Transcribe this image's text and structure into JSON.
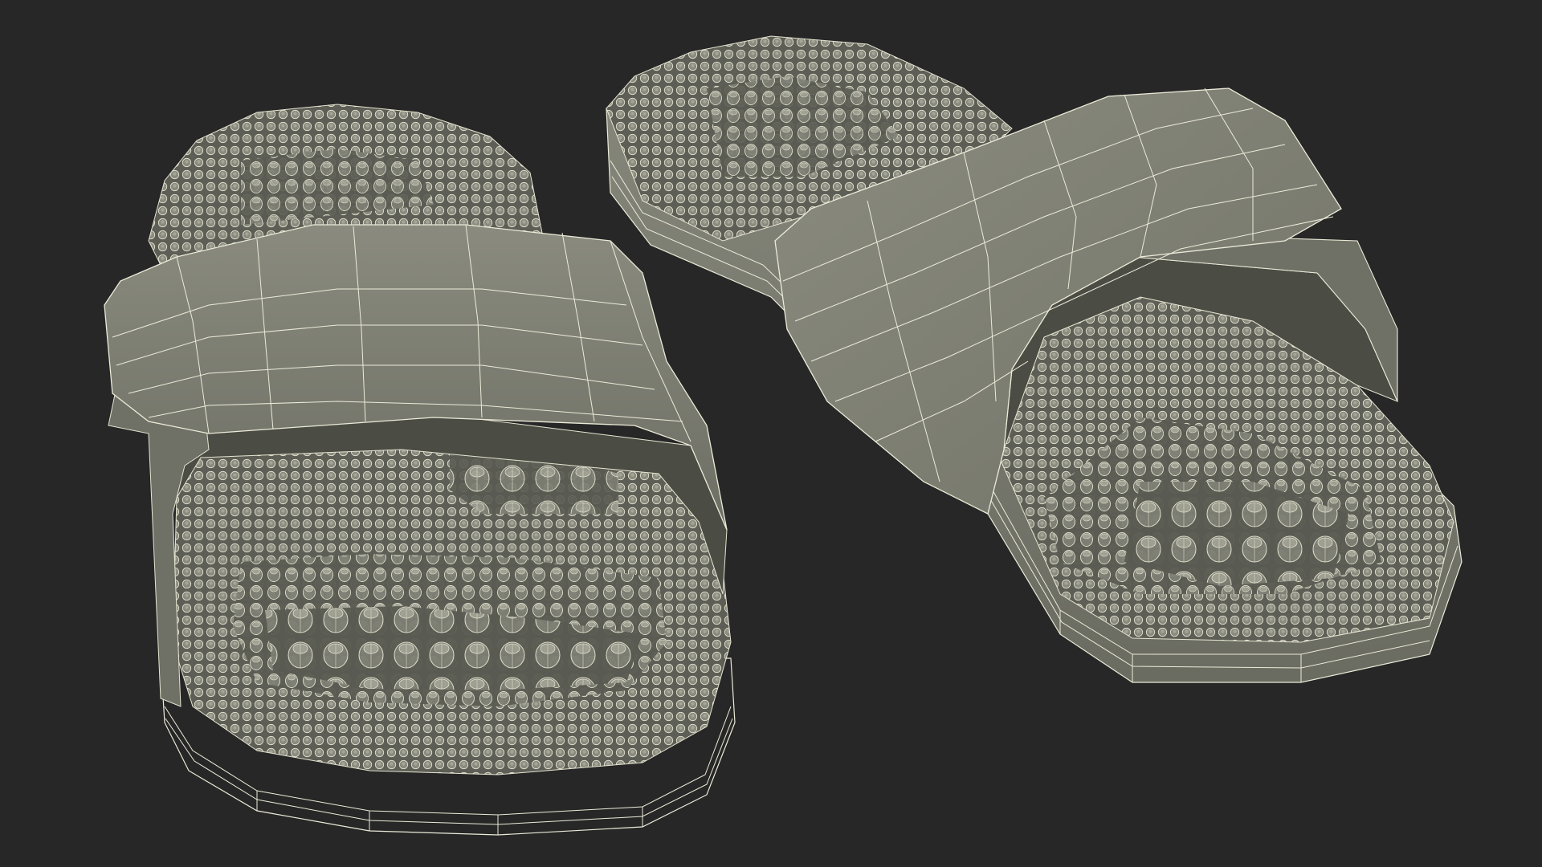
{
  "scene": {
    "background_color": "#272727",
    "model_color": "#7c7d71",
    "model_shadow_color": "#5e5f55",
    "model_light_color": "#8e8f82",
    "wire_color": "#ecebd9",
    "objects": [
      {
        "name": "left-massage-slipper",
        "nub_density_ratio": 1.0
      },
      {
        "name": "right-massage-slipper",
        "nub_density_ratio": 1.0
      }
    ]
  }
}
